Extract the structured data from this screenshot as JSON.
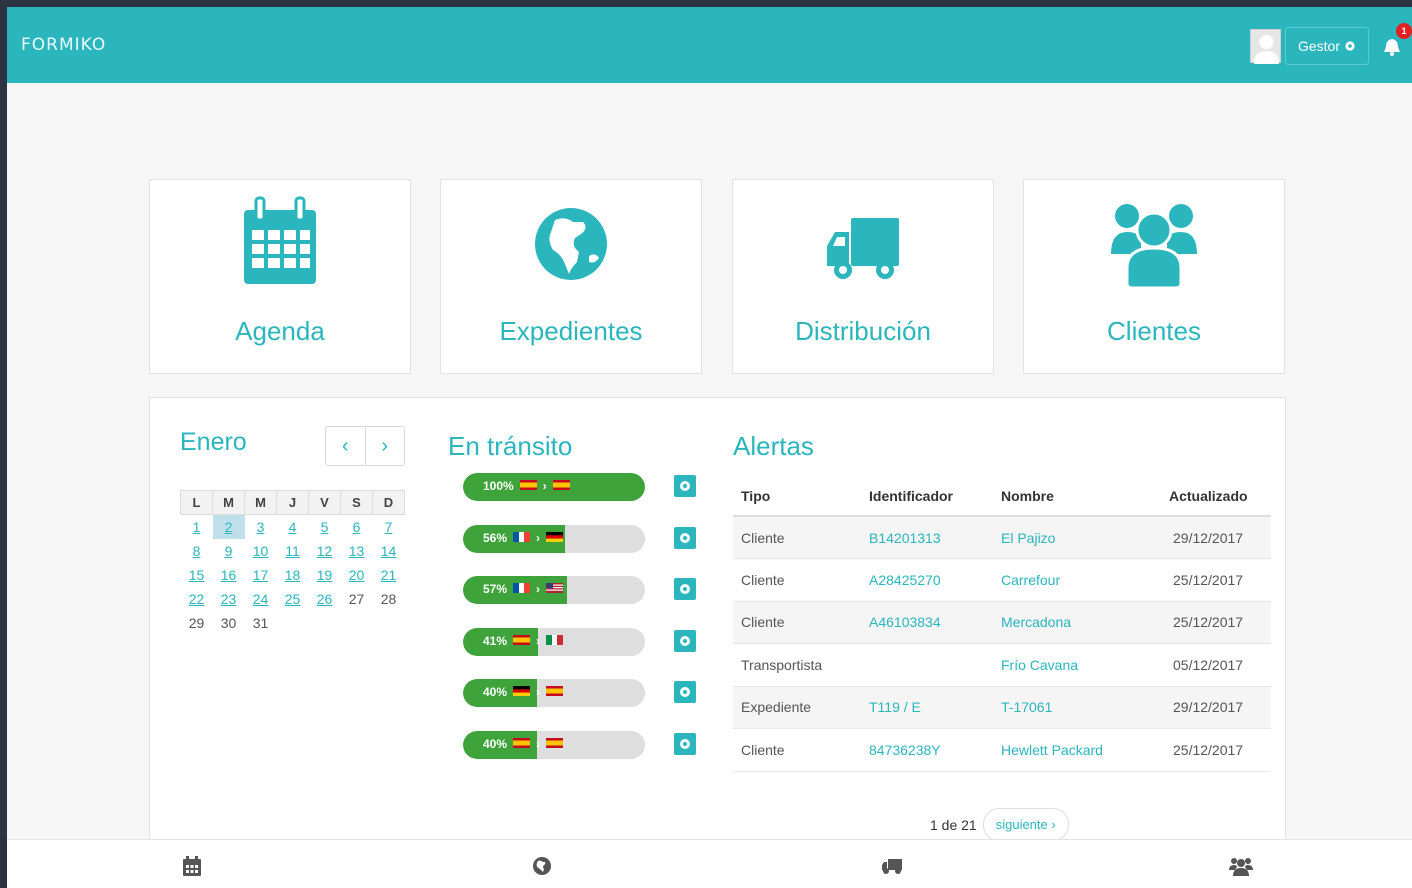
{
  "brand": "FORMIKO",
  "colors": {
    "accent": "#2bb5bc",
    "progress": "#3da33a",
    "badge": "#e32121"
  },
  "header": {
    "user_button": "Gestor",
    "notifications": "1"
  },
  "tiles": [
    {
      "label": "Agenda",
      "icon": "calendar-icon"
    },
    {
      "label": "Expedientes",
      "icon": "globe-icon"
    },
    {
      "label": "Distribución",
      "icon": "truck-icon"
    },
    {
      "label": "Clientes",
      "icon": "users-icon"
    }
  ],
  "calendar": {
    "month": "Enero",
    "weekdays": [
      "L",
      "M",
      "M",
      "J",
      "V",
      "S",
      "D"
    ],
    "weeks": [
      [
        "",
        "1",
        "2",
        "3",
        "4",
        "5",
        "6",
        "7"
      ],
      [
        "8",
        "9",
        "10",
        "11",
        "12",
        "13",
        "14"
      ],
      [
        "15",
        "16",
        "17",
        "18",
        "19",
        "20",
        "21"
      ],
      [
        "22",
        "23",
        "24",
        "25",
        "26",
        "27",
        "28"
      ],
      [
        "29",
        "30",
        "31"
      ]
    ]
  },
  "transit": {
    "title": "En tránsito",
    "items": [
      {
        "percent": "100%",
        "progress": 1.0,
        "from": "es",
        "to": "es"
      },
      {
        "percent": "56%",
        "progress": 0.56,
        "from": "fr",
        "to": "de"
      },
      {
        "percent": "57%",
        "progress": 0.57,
        "from": "fr",
        "to": "us"
      },
      {
        "percent": "41%",
        "progress": 0.41,
        "from": "es",
        "to": "it"
      },
      {
        "percent": "40%",
        "progress": 0.4,
        "from": "de",
        "to": "es"
      },
      {
        "percent": "40%",
        "progress": 0.4,
        "from": "es",
        "to": "es"
      }
    ]
  },
  "alerts": {
    "title": "Alertas",
    "columns": [
      "Tipo",
      "Identificador",
      "Nombre",
      "Actualizado"
    ],
    "rows": [
      [
        "Cliente",
        "B14201313",
        "El Pajizo",
        "29/12/2017"
      ],
      [
        "Cliente",
        "A28425270",
        "Carrefour",
        "25/12/2017"
      ],
      [
        "Cliente",
        "A46103834",
        "Mercadona",
        "25/12/2017"
      ],
      [
        "Transportista",
        "",
        "Frío Cavana",
        "05/12/2017"
      ],
      [
        "Expediente",
        "T119 / E",
        "T-17061",
        "29/12/2017"
      ],
      [
        "Cliente",
        "84736238Y",
        "Hewlett Packard",
        "25/12/2017"
      ]
    ],
    "pager": {
      "status": "1 de 21",
      "next": "siguiente ›"
    }
  },
  "bottom_nav": [
    "calendar-icon",
    "globe-icon",
    "truck-icon",
    "users-icon"
  ]
}
